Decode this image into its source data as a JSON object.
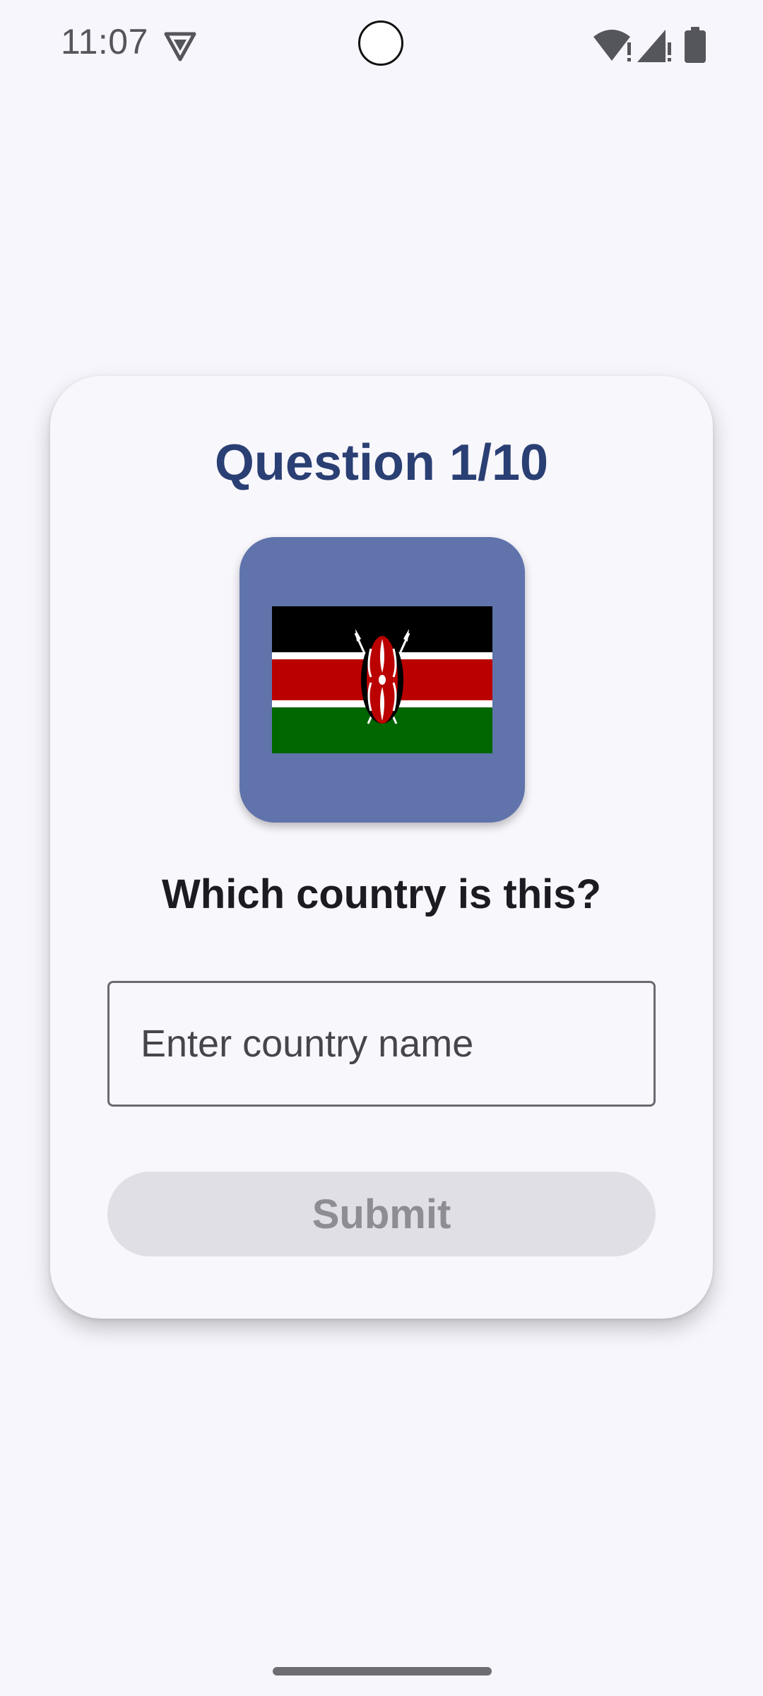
{
  "status_bar": {
    "time": "11:07",
    "icons": [
      "vpn-icon",
      "wifi-icon",
      "cell-signal-icon",
      "battery-icon"
    ]
  },
  "quiz": {
    "title": "Question 1/10",
    "flag_icon": "kenya-flag",
    "prompt": "Which country is this?",
    "input_placeholder": "Enter country name",
    "input_value": "",
    "submit_label": "Submit"
  },
  "colors": {
    "title": "#2a3f73",
    "flag_frame": "#6073ab",
    "submit_disabled_bg": "#e0dfe5",
    "submit_disabled_text": "#8e8d93",
    "background": "#f7f6fc"
  }
}
